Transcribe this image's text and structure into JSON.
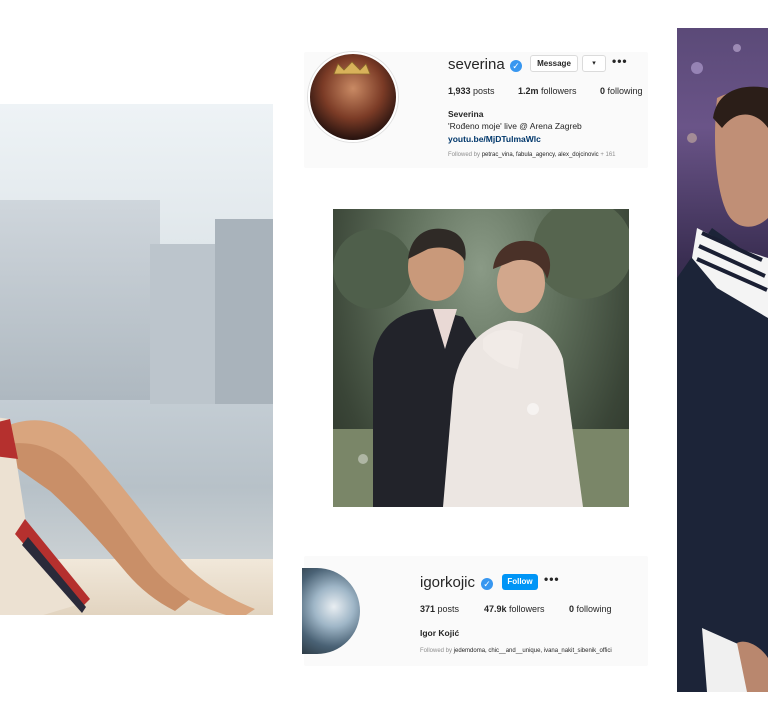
{
  "profile_severina": {
    "username": "severina",
    "verified_icon": "verified-badge-icon",
    "message_label": "Message",
    "posts": "1,933",
    "posts_label": " posts",
    "followers": "1.2m",
    "followers_label": " followers",
    "following": "0",
    "following_label": " following",
    "name": "Severina",
    "bio": "'Rođeno moje' live @ Arena Zagreb",
    "link": "youtu.be/MjDTulmaWlc",
    "followed_by_prefix": "Followed by ",
    "followed_by_names": "petrac_vina, fabula_agency, alex_dojcinovic",
    "followed_by_suffix": " + 161"
  },
  "profile_igor": {
    "username": "igorkojic",
    "verified_icon": "verified-badge-icon",
    "follow_label": "Follow",
    "posts": "371",
    "posts_label": " posts",
    "followers": "47.9k",
    "followers_label": " followers",
    "following": "0",
    "following_label": " following",
    "name": "Igor Kojić",
    "followed_by_prefix": "Followed by ",
    "followed_by_names": "jedemdoma, chic__and__unique, ivana_nakit_sibenik_offici"
  },
  "icons": {
    "more": "•••",
    "person": "👤",
    "check": "✓"
  },
  "colors": {
    "follow_button": "#0095f6",
    "verified": "#3897f0",
    "link": "#00376b"
  }
}
